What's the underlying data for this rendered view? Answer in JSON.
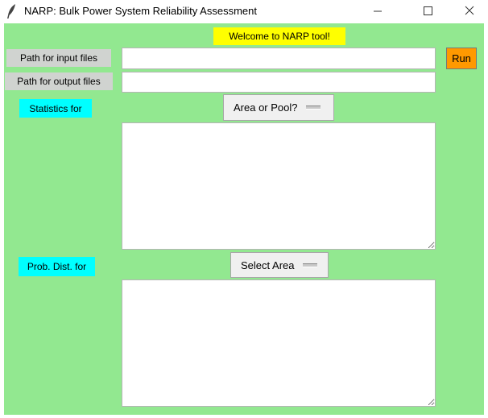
{
  "window": {
    "title": "NARP: Bulk Power System Reliability Assessment",
    "app_icon": "feather-icon"
  },
  "header": {
    "welcome": "Welcome to NARP tool!"
  },
  "inputs": {
    "input_label": "Path for input files",
    "input_value": "",
    "output_label": "Path for output files",
    "output_value": ""
  },
  "run_label": "Run",
  "statistics": {
    "label": "Statistics for",
    "selected": "Area or Pool?"
  },
  "distribution": {
    "label": "Prob. Dist. for",
    "selected": "Select Area"
  },
  "colors": {
    "background": "#92e890",
    "welcome": "#ffff00",
    "section_label": "#00ffff",
    "path_label": "#d0d3d0",
    "run_button": "#ff9900"
  }
}
